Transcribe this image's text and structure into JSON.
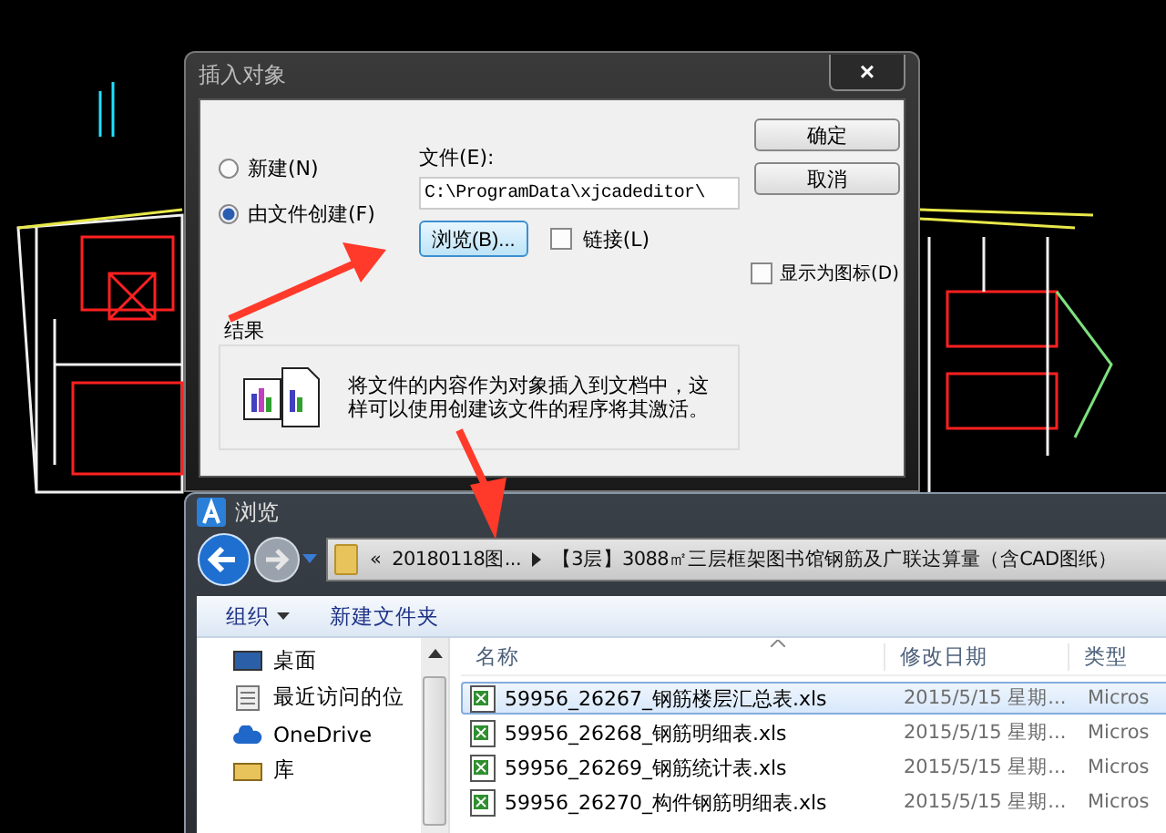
{
  "insert_dialog": {
    "title": "插入对象",
    "close": "×",
    "options": [
      {
        "label": "新建(N)",
        "selected": false
      },
      {
        "label": "由文件创建(F)",
        "selected": true
      }
    ],
    "file_label": "文件(E):",
    "file_value": "C:\\ProgramData\\xjcadeditor\\",
    "browse_button": "浏览(B)...",
    "link": {
      "label": "链接(L)",
      "checked": false
    },
    "buttons": [
      "确定",
      "取消"
    ],
    "display_as_icon": {
      "label": "显示为图标(D)",
      "checked": false
    },
    "result": {
      "title": "结果",
      "text": "将文件的内容作为对象插入到文档中，这样可以使用创建该文件的程序将其激活。"
    }
  },
  "browse_window": {
    "title": "浏览",
    "breadcrumb": [
      "«",
      "20180118图...",
      "【3层】3088㎡三层框架图书馆钢筋及广联达算量（含CAD图纸）"
    ],
    "toolbar": [
      "组织",
      "新建文件夹"
    ],
    "nav": [
      {
        "label": "桌面",
        "kind": "desktop"
      },
      {
        "label": "最近访问的位",
        "kind": "recent"
      },
      {
        "label": "OneDrive",
        "kind": "cloud"
      },
      {
        "label": "库",
        "kind": "library"
      }
    ],
    "columns": [
      "名称",
      "修改日期",
      "类型"
    ],
    "files": [
      {
        "name": "59956_26267_钢筋楼层汇总表.xls",
        "date": "2015/5/15 星期...",
        "type": "Micros",
        "selected": true
      },
      {
        "name": "59956_26268_钢筋明细表.xls",
        "date": "2015/5/15 星期...",
        "type": "Micros",
        "selected": false
      },
      {
        "name": "59956_26269_钢筋统计表.xls",
        "date": "2015/5/15 星期...",
        "type": "Micros",
        "selected": false
      },
      {
        "name": "59956_26270_构件钢筋明细表.xls",
        "date": "2015/5/15 星期...",
        "type": "Micros",
        "selected": false
      }
    ]
  }
}
